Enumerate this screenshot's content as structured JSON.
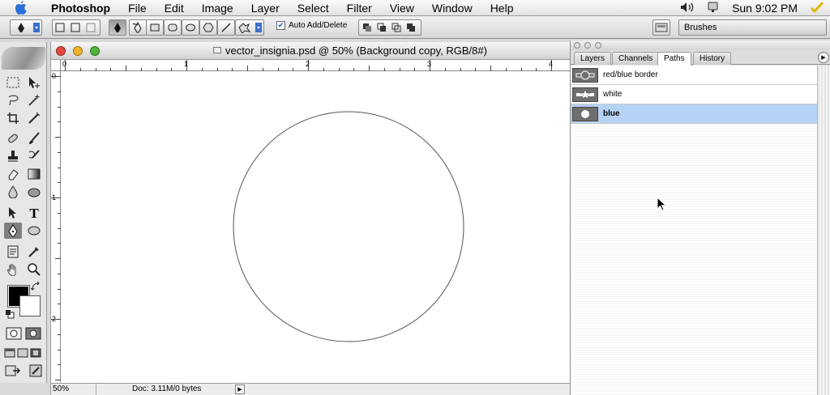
{
  "menubar": {
    "app_name": "Photoshop",
    "items": [
      "File",
      "Edit",
      "Image",
      "Layer",
      "Select",
      "Filter",
      "View",
      "Window",
      "Help"
    ],
    "clock": "Sun 9:02 PM",
    "icons": [
      "apple-icon",
      "volume-icon",
      "display-icon",
      "checkmark-icon"
    ]
  },
  "options_bar": {
    "auto_add_delete_label": "Auto Add/Delete",
    "auto_add_delete_checked": true,
    "brushes_tab_label": "Brushes"
  },
  "document": {
    "title": "vector_insignia.psd @ 50% (Background copy, RGB/8#)",
    "ruler_h_labels": [
      "0",
      "1",
      "2",
      "3",
      "4"
    ],
    "ruler_v_labels": [
      "0",
      "1",
      "2"
    ],
    "zoom": "50%",
    "doc_info": "Doc: 3.11M/0 bytes"
  },
  "paths_palette": {
    "tabs": [
      "Layers",
      "Channels",
      "Paths",
      "History"
    ],
    "active_tab": "Paths",
    "paths": [
      {
        "name": "red/blue border",
        "selected": false
      },
      {
        "name": "white",
        "selected": false
      },
      {
        "name": "blue",
        "selected": true
      }
    ]
  },
  "colors": {
    "selection": "#b6d3f5",
    "foreground": "#000000",
    "background": "#ffffff",
    "close": "#e4473c",
    "minimize": "#f1b32a",
    "zoom": "#4fb43a"
  }
}
